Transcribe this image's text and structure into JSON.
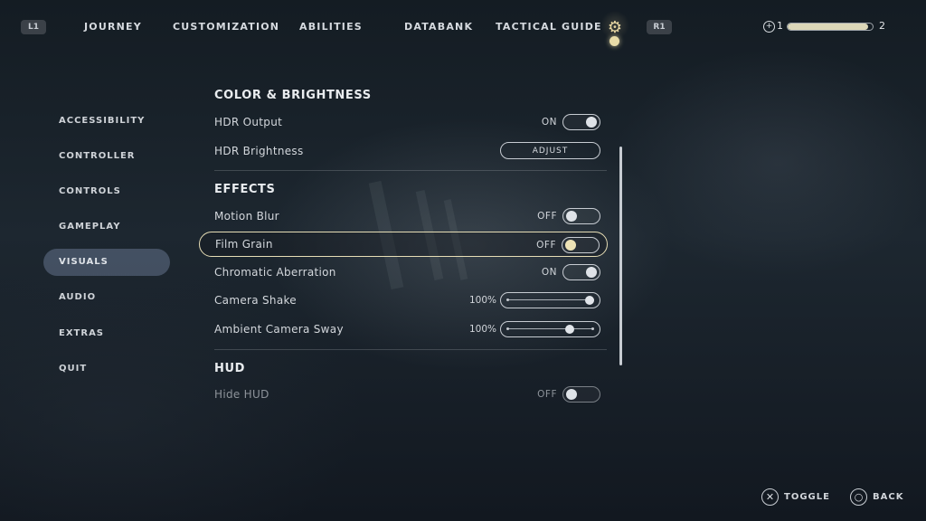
{
  "nav": {
    "left_bumper": "L1",
    "right_bumper": "R1",
    "tabs": [
      "JOURNEY",
      "CUSTOMIZATION",
      "ABILITIES",
      "DATABANK",
      "TACTICAL GUIDE"
    ],
    "settings_icon": "gear-icon",
    "level": {
      "current": "1",
      "next": "2",
      "progress": 0.95
    }
  },
  "sidebar": {
    "items": [
      "ACCESSIBILITY",
      "CONTROLLER",
      "CONTROLS",
      "GAMEPLAY",
      "VISUALS",
      "AUDIO",
      "EXTRAS",
      "QUIT"
    ],
    "active": "VISUALS"
  },
  "sections": {
    "color": {
      "title": "COLOR & BRIGHTNESS",
      "hdr_output": {
        "label": "HDR Output",
        "state": "ON"
      },
      "hdr_brightness": {
        "label": "HDR Brightness",
        "button": "ADJUST"
      }
    },
    "effects": {
      "title": "EFFECTS",
      "motion_blur": {
        "label": "Motion Blur",
        "state": "OFF"
      },
      "film_grain": {
        "label": "Film Grain",
        "state": "OFF"
      },
      "chromatic": {
        "label": "Chromatic Aberration",
        "state": "ON"
      },
      "camera_shake": {
        "label": "Camera Shake",
        "value": "100%",
        "level": 1.0
      },
      "camera_sway": {
        "label": "Ambient Camera Sway",
        "value": "100%",
        "level": 0.75
      }
    },
    "hud": {
      "title": "HUD",
      "hide_hud": {
        "label": "Hide HUD",
        "state": "OFF"
      }
    }
  },
  "hints": {
    "toggle": {
      "icon": "cross-button-icon",
      "label": "TOGGLE"
    },
    "back": {
      "icon": "circle-button-icon",
      "label": "BACK"
    }
  },
  "colors": {
    "accent": "#e6ddb5",
    "active_tab_bg": "#56657c"
  }
}
